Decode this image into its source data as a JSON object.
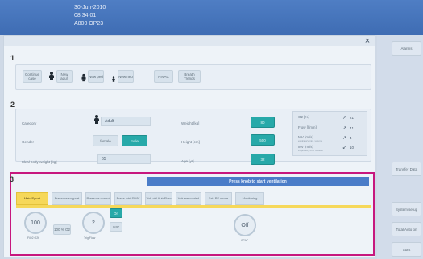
{
  "header": {
    "date": "30-Jun-2010",
    "time": "08:34:01",
    "id": "A800 OP23"
  },
  "close_label": "×",
  "sections": {
    "s1": "1",
    "s2": "2",
    "s3": "3"
  },
  "patient_category": {
    "buttons": [
      {
        "label": "Continue case"
      },
      {
        "label": "New adult"
      },
      {
        "label": "New ped"
      },
      {
        "label": "New neo"
      },
      {
        "label": "NIVAC"
      },
      {
        "label": "Breath Trends"
      }
    ]
  },
  "patient_data": {
    "category_label": "Category",
    "category_value": "Adult",
    "gender_label": "Gender",
    "gender_female": "female",
    "gender_male": "male",
    "ibw_label": "Ideal body weight [kg]",
    "ibw_value": "65",
    "weight_label": "Weight [kg]",
    "weight_value": "80",
    "height_label": "Height [cm]",
    "height_value": "500",
    "age_label": "Age [yr]",
    "age_value": "32"
  },
  "metrics": [
    {
      "label": "O2 [%]",
      "sub": "",
      "value": "21"
    },
    {
      "label": "Flow [l/min]",
      "sub": "",
      "value": "41"
    },
    {
      "label": "MV [ml/s]",
      "sub": "expiratory min. volume",
      "value": "4"
    },
    {
      "label": "MV [ml/s]",
      "sub": "inspiratory min. volume",
      "value": "10"
    }
  ],
  "ventilation": {
    "banner": "Press knob to start ventilation",
    "tabs": [
      {
        "label": "Main/Spont",
        "active": true
      },
      {
        "label": "Pressure support",
        "active": false
      },
      {
        "label": "Pressure control",
        "active": false
      },
      {
        "label": "Press. ctrl SIMV",
        "active": false
      },
      {
        "label": "Vol. ctrl AutoFlow",
        "active": false
      },
      {
        "label": "Volume control",
        "active": false
      },
      {
        "label": "Ext. PS mode",
        "active": false
      },
      {
        "label": "Monitoring",
        "active": false
      }
    ],
    "dial1_value": "100",
    "dial1_label": "FiO2 O2t",
    "percent_box": "100 % O2",
    "dial2_value": "2",
    "dial2_label": "Trig Flow",
    "on_label": "On",
    "nasal_label": "NIV",
    "dial3_value": "Off",
    "dial3_label": "CPAP"
  },
  "right_buttons": {
    "alarms": "Alarms",
    "transfer": "Transfer Data",
    "system": "System setup",
    "total": "Total Auto on",
    "start": "Start"
  }
}
